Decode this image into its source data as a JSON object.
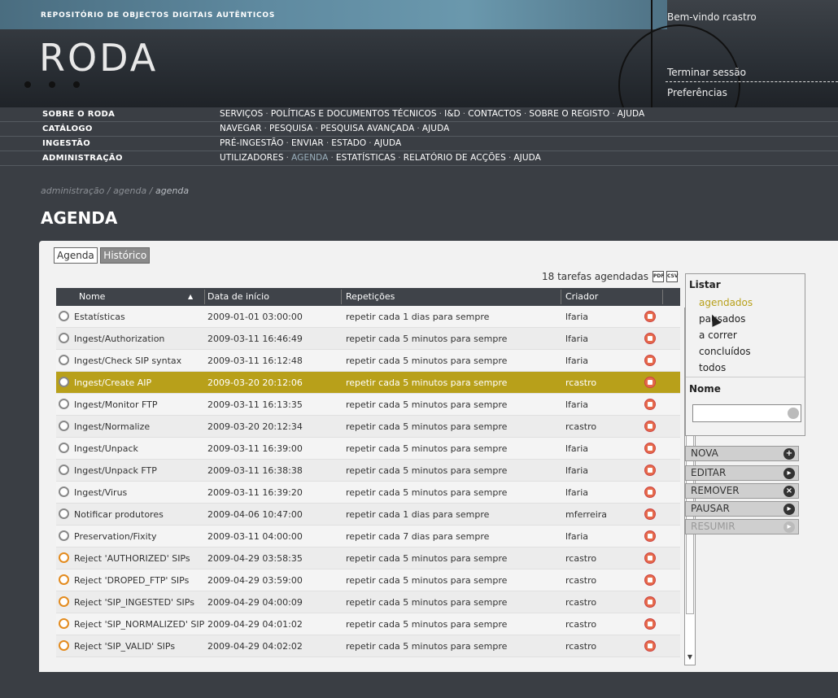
{
  "header": {
    "tagline": "REPOSITÓRIO DE OBJECTOS DIGITAIS AUTÊNTICOS",
    "logo": "RODA",
    "welcome": "Bem-vindo rcastro",
    "logout": "Terminar sessão",
    "preferences": "Preferências"
  },
  "menu": [
    {
      "section": "SOBRE O RODA",
      "links": [
        "SERVIÇOS",
        "POLÍTICAS E DOCUMENTOS TÉCNICOS",
        "I&D",
        "CONTACTOS",
        "SOBRE O REGISTO",
        "AJUDA"
      ]
    },
    {
      "section": "CATÁLOGO",
      "links": [
        "NAVEGAR",
        "PESQUISA",
        "PESQUISA AVANÇADA",
        "AJUDA"
      ]
    },
    {
      "section": "INGESTÃO",
      "links": [
        "PRÉ-INGESTÃO",
        "ENVIAR",
        "ESTADO",
        "AJUDA"
      ]
    },
    {
      "section": "ADMINISTRAÇÃO",
      "links": [
        "UTILIZADORES",
        "AGENDA",
        "ESTATÍSTICAS",
        "RELATÓRIO DE ACÇÕES",
        "AJUDA"
      ]
    }
  ],
  "breadcrumb": {
    "p1": "administração",
    "p2": "agenda",
    "p3": "agenda"
  },
  "page_title": "AGENDA",
  "tabs": {
    "agenda": "Agenda",
    "history": "Histórico"
  },
  "task_count": "18 tarefas agendadas",
  "export": {
    "pdf": "PDF",
    "csv": "CSV"
  },
  "table": {
    "headers": {
      "name": "Nome",
      "start": "Data de início",
      "repeat": "Repetições",
      "creator": "Criador"
    },
    "rows": [
      {
        "name": "Estatísticas",
        "start": "2009-01-01 03:00:00",
        "repeat": "repetir cada 1 dias para sempre",
        "creator": "lfaria"
      },
      {
        "name": "Ingest/Authorization",
        "start": "2009-03-11 16:46:49",
        "repeat": "repetir cada 5 minutos para sempre",
        "creator": "lfaria"
      },
      {
        "name": "Ingest/Check SIP syntax",
        "start": "2009-03-11 16:12:48",
        "repeat": "repetir cada 5 minutos para sempre",
        "creator": "lfaria"
      },
      {
        "name": "Ingest/Create AIP",
        "start": "2009-03-20 20:12:06",
        "repeat": "repetir cada 5 minutos para sempre",
        "creator": "rcastro"
      },
      {
        "name": "Ingest/Monitor FTP",
        "start": "2009-03-11 16:13:35",
        "repeat": "repetir cada 5 minutos para sempre",
        "creator": "lfaria"
      },
      {
        "name": "Ingest/Normalize",
        "start": "2009-03-20 20:12:34",
        "repeat": "repetir cada 5 minutos para sempre",
        "creator": "rcastro"
      },
      {
        "name": "Ingest/Unpack",
        "start": "2009-03-11 16:39:00",
        "repeat": "repetir cada 5 minutos para sempre",
        "creator": "lfaria"
      },
      {
        "name": "Ingest/Unpack FTP",
        "start": "2009-03-11 16:38:38",
        "repeat": "repetir cada 5 minutos para sempre",
        "creator": "lfaria"
      },
      {
        "name": "Ingest/Virus",
        "start": "2009-03-11 16:39:20",
        "repeat": "repetir cada 5 minutos para sempre",
        "creator": "lfaria"
      },
      {
        "name": "Notificar produtores",
        "start": "2009-04-06 10:47:00",
        "repeat": "repetir cada 1 dias para sempre",
        "creator": "mferreira"
      },
      {
        "name": "Preservation/Fixity",
        "start": "2009-03-11 04:00:00",
        "repeat": "repetir cada 7 dias para sempre",
        "creator": "lfaria"
      },
      {
        "name": "Reject 'AUTHORIZED' SIPs",
        "start": "2009-04-29 03:58:35",
        "repeat": "repetir cada 5 minutos para sempre",
        "creator": "rcastro"
      },
      {
        "name": "Reject 'DROPED_FTP' SIPs",
        "start": "2009-04-29 03:59:00",
        "repeat": "repetir cada 5 minutos para sempre",
        "creator": "rcastro"
      },
      {
        "name": "Reject 'SIP_INGESTED' SIPs",
        "start": "2009-04-29 04:00:09",
        "repeat": "repetir cada 5 minutos para sempre",
        "creator": "rcastro"
      },
      {
        "name": "Reject 'SIP_NORMALIZED' SIPs",
        "start": "2009-04-29 04:01:02",
        "repeat": "repetir cada 5 minutos para sempre",
        "creator": "rcastro"
      },
      {
        "name": "Reject 'SIP_VALID' SIPs",
        "start": "2009-04-29 04:02:02",
        "repeat": "repetir cada 5 minutos para sempre",
        "creator": "rcastro"
      }
    ]
  },
  "side": {
    "list_title": "Listar",
    "filters": [
      "agendados",
      "pausados",
      "a correr",
      "concluídos",
      "todos"
    ],
    "name_title": "Nome",
    "name_value": ""
  },
  "buttons": {
    "new": "NOVA",
    "edit": "EDITAR",
    "remove": "REMOVER",
    "pause": "PAUSAR",
    "resume": "RESUMIR"
  },
  "colors": {
    "accent": "#b8a01a",
    "header_dark": "#3a3e44",
    "stop_red": "#e66a4a"
  }
}
